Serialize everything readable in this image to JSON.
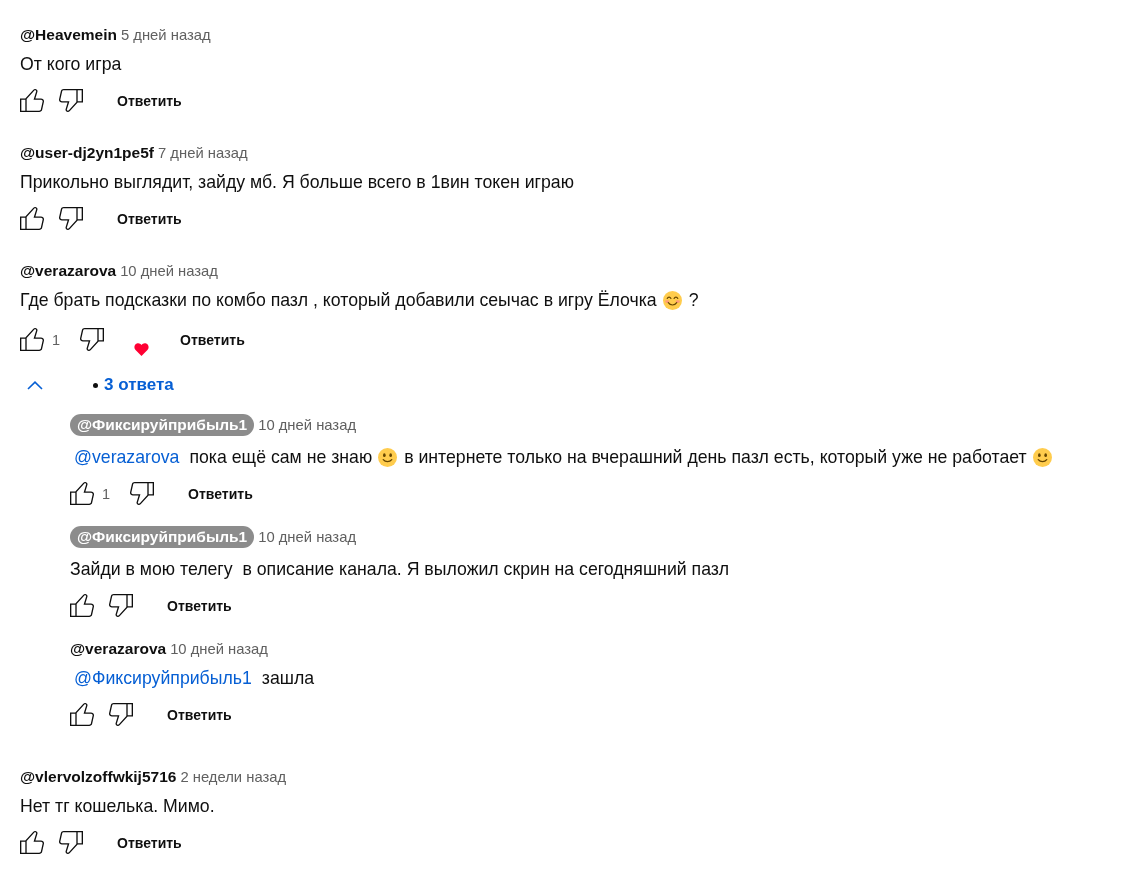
{
  "comments": [
    {
      "author": "@Heavemein",
      "owner": false,
      "time": "5 дней назад",
      "body": [
        {
          "kind": "text",
          "text": "От кого игра"
        }
      ],
      "hearted": false,
      "reply_button": "Ответить"
    },
    {
      "author": "@user-dj2yn1pe5f",
      "owner": false,
      "time": "7 дней назад",
      "body": [
        {
          "kind": "text",
          "text": "Прикольно выглядит, зайду мб. Я больше всего в 1вин токен играю"
        }
      ],
      "hearted": false,
      "reply_button": "Ответить"
    },
    {
      "author": "@verazarova",
      "owner": false,
      "time": "10 дней назад",
      "body": [
        {
          "kind": "text",
          "text": "Где брать подсказки по комбо пазл , который добавили сеычас в игру Ёлочка"
        },
        {
          "kind": "blush"
        },
        {
          "kind": "text",
          "text": "?"
        }
      ],
      "likes": "1",
      "hearted": true,
      "reply_button": "Ответить",
      "replies": {
        "label": "3 ответа",
        "expanded": true,
        "items": [
          {
            "author": "@Фиксируйприбыль1",
            "owner": true,
            "time": "10 дней назад",
            "body": [
              {
                "kind": "mention",
                "text": "@verazarova"
              },
              {
                "kind": "text",
                "text": "пока ещё сам не знаю"
              },
              {
                "kind": "smile"
              },
              {
                "kind": "text",
                "text": "в интернете только на вчерашний день пазл есть, который уже не работает"
              },
              {
                "kind": "smile"
              }
            ],
            "likes": "1",
            "hearted": false,
            "reply_button": "Ответить"
          },
          {
            "author": "@Фиксируйприбыль1",
            "owner": true,
            "time": "10 дней назад",
            "body": [
              {
                "kind": "text",
                "text": "Зайди в мою телегу  в описание канала. Я выложил скрин на сегодняшний пазл"
              }
            ],
            "hearted": false,
            "reply_button": "Ответить"
          },
          {
            "author": "@verazarova",
            "owner": false,
            "time": "10 дней назад",
            "body": [
              {
                "kind": "mention",
                "text": "@Фиксируйприбыль1"
              },
              {
                "kind": "text",
                "text": "зашла"
              }
            ],
            "hearted": false,
            "reply_button": "Ответить"
          }
        ]
      }
    },
    {
      "author": "@vlervolzoffwkij5716",
      "owner": false,
      "time": "2 недели назад",
      "body": [
        {
          "kind": "text",
          "text": "Нет тг кошелька. Мимо."
        }
      ],
      "hearted": false,
      "reply_button": "Ответить"
    }
  ]
}
